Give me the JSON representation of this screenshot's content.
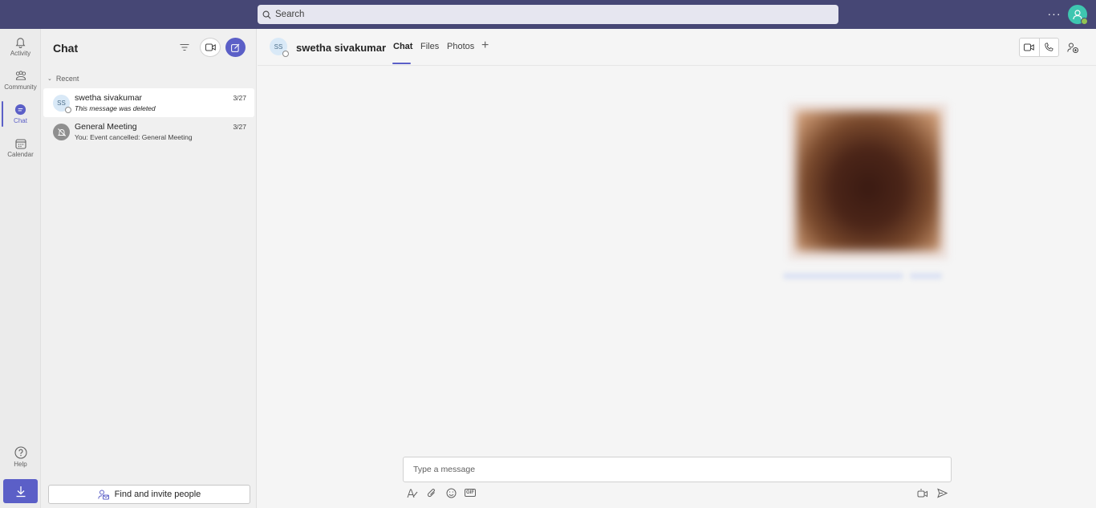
{
  "topbar": {
    "search_placeholder": "Search",
    "more_label": "···",
    "accent_color": "#464775"
  },
  "rail": {
    "items": [
      {
        "label": "Activity",
        "icon": "bell-icon"
      },
      {
        "label": "Community",
        "icon": "community-icon"
      },
      {
        "label": "Chat",
        "icon": "chat-icon",
        "active": true
      },
      {
        "label": "Calendar",
        "icon": "calendar-icon"
      }
    ],
    "help_label": "Help",
    "download_icon": "download-icon"
  },
  "chat_panel": {
    "title": "Chat",
    "section_label": "Recent",
    "chats": [
      {
        "name": "swetha sivakumar",
        "initials": "SS",
        "preview": "This message was deleted",
        "date": "3/27",
        "selected": true
      },
      {
        "name": "General Meeting",
        "initials": "",
        "preview": "You: Event cancelled: General Meeting",
        "date": "3/27",
        "selected": false
      }
    ],
    "invite_label": "Find and invite people"
  },
  "conversation": {
    "initials": "SS",
    "name": "swetha sivakumar",
    "tabs": [
      {
        "label": "Chat",
        "active": true
      },
      {
        "label": "Files",
        "active": false
      },
      {
        "label": "Photos",
        "active": false
      }
    ],
    "add_tab_label": "+",
    "compose_placeholder": "Type a message",
    "brand_color": "#5b5fc7"
  }
}
